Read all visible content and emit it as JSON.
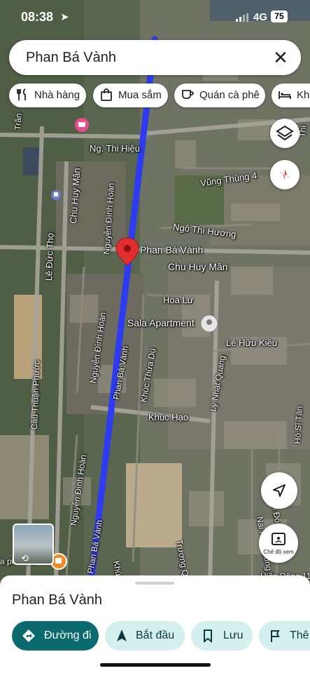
{
  "status_bar": {
    "time": "08:38",
    "network": "4G",
    "battery": "75"
  },
  "search": {
    "query": "Phan Bá Vành"
  },
  "chips": [
    {
      "icon": "restaurant-icon",
      "label": "Nhà hàng"
    },
    {
      "icon": "shopping-bag-icon",
      "label": "Mua sắm"
    },
    {
      "icon": "coffee-icon",
      "label": "Quán cà phê"
    },
    {
      "icon": "hotel-icon",
      "label": "Khá"
    }
  ],
  "map": {
    "route_color": "#2d3cf0",
    "pin_color": "#e02d2d",
    "labels": {
      "ng_thi_hieu": "Ng. Thi Hiệu",
      "chu_huy_man_v": "Chu Huy Mân",
      "nguyen_dinh_hoan_1": "Nguyễn Đình Hoàn",
      "le_duc_tho": "Lê Đức Thọ",
      "vung_thung_4": "Vũng Thùng 4",
      "ngo_thi_huong": "Ngô Thì Hương",
      "phan_ba_vanh_pin": "Phan Bá Vành",
      "chu_huy_man_h": "Chu Huy Mân",
      "hoa_lu": "Hoa Lư",
      "sala_apartment": "Sala Apartment",
      "le_huu_kieu": "Lê Hữu Kiều",
      "nguyen_dinh_hoan_2": "Nguyễn Đình Hoàn",
      "khuc_thua_du": "Khúc Thừa Dụ",
      "phan_ba_vanh_road": "Phan Bá Vành",
      "ly_nhat_quang": "Lý Nhật Quang",
      "cau_thuan_phuoc": "Cầu Thuận Phước",
      "khuc_hao": "Khúc Hạo",
      "ho_si_tan": "Hồ Sĩ Tân",
      "nai_hien_dong_15": "Nại Hiên Đông 15",
      "nai_hien_dong_12": "Nại Hiên Đông 12",
      "nguyen_dinh_hoan_3": "Nguyễn Đình Hoàn",
      "phan_ba_vanh_road2": "Phan Bá Vành",
      "khuc_thua_du_2": "Khúc Thừa Dụ",
      "truong": "Trương Q",
      "hien_dong_11": "Hiên Đông 11",
      "tran": "Trần",
      "thi": "Thi",
      "ho_si_tan_2": "Hồ S",
      "pho_cafe": "a phê Car"
    }
  },
  "controls": {
    "street_view_label": "Chế độ xem"
  },
  "bottom_sheet": {
    "place_name": "Phan Bá Vành",
    "actions": [
      {
        "icon": "directions-icon",
        "label": "Đường đi"
      },
      {
        "icon": "navigation-arrow-icon",
        "label": "Bắt đầu"
      },
      {
        "icon": "bookmark-icon",
        "label": "Lưu"
      },
      {
        "icon": "flag-icon",
        "label": "Thê"
      }
    ]
  }
}
